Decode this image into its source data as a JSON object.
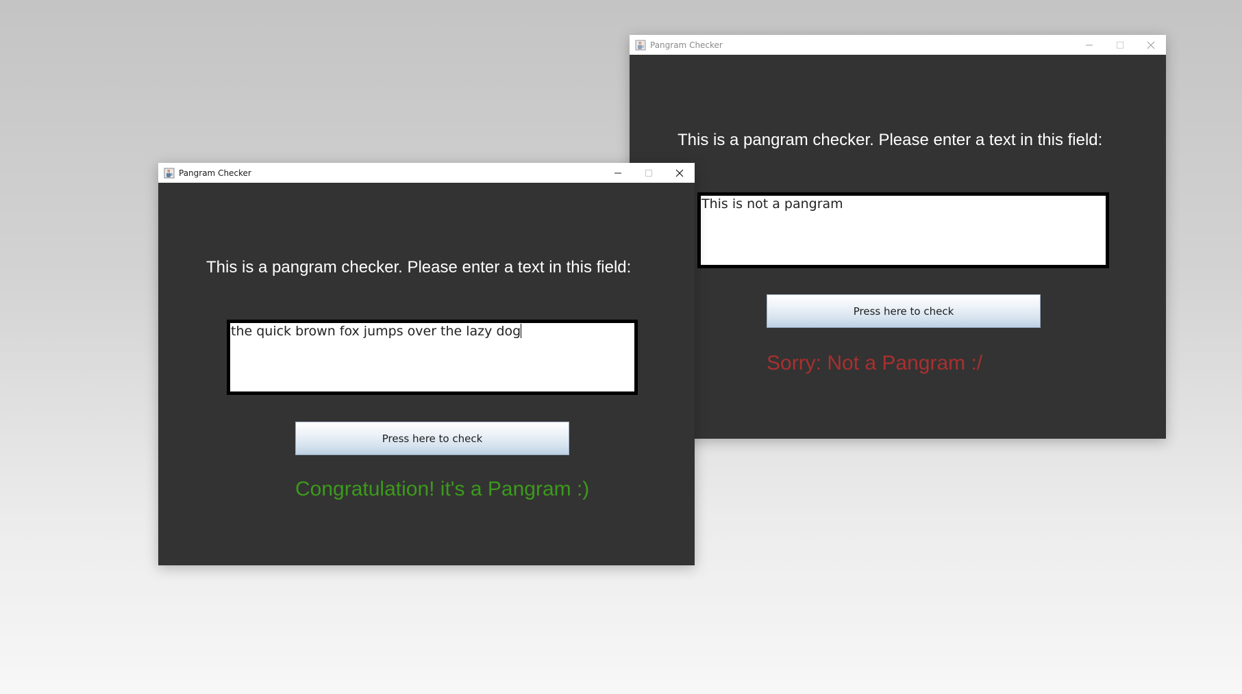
{
  "background_window": {
    "title": "Pangram Checker",
    "prompt": "This is a pangram checker. Please enter a text in this field:",
    "input_value": "This is not a pangram",
    "button_label": "Press here to check",
    "result_text": "Sorry: Not a Pangram :/",
    "result_color": "#a8302f"
  },
  "foreground_window": {
    "title": "Pangram Checker",
    "prompt": "This is a pangram checker. Please enter a text in this field:",
    "input_value": "the quick brown fox jumps over the lazy dog",
    "button_label": "Press here to check",
    "result_text": "Congratulation! it's a Pangram :)",
    "result_color": "#3c9a1c"
  },
  "icons": {
    "app": "java-cup-icon",
    "minimize": "minimize-icon",
    "maximize": "maximize-icon",
    "close": "close-icon"
  },
  "colors": {
    "window_body": "#333333",
    "titlebar": "#ffffff"
  }
}
